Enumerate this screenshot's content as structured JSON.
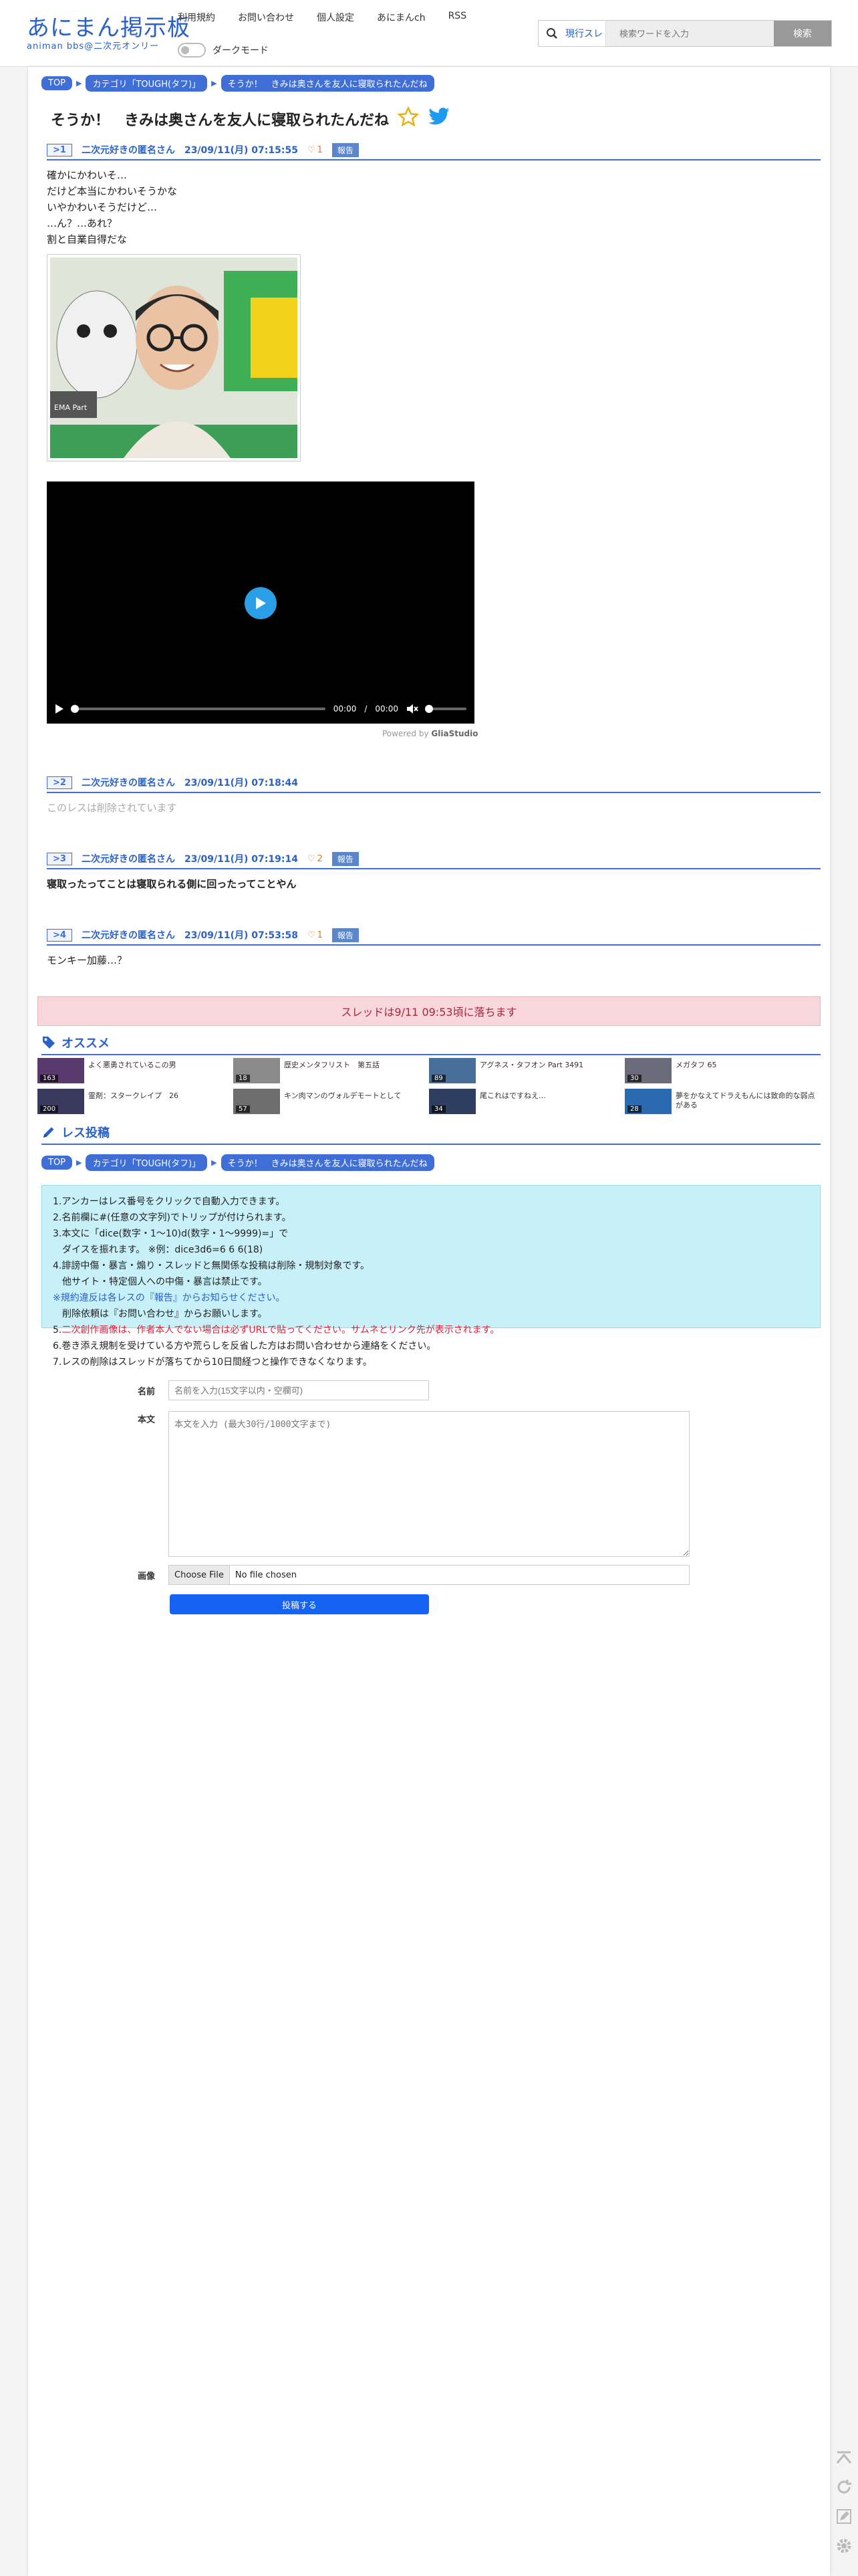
{
  "header": {
    "logo_main": "あにまん掲示板",
    "logo_sub": "animan bbs@二次元オンリー",
    "nav": [
      "利用規約",
      "お問い合わせ",
      "個人設定",
      "あにまんch",
      "RSS"
    ],
    "dark_mode_label": "ダークモード",
    "search_type": "現行スレ",
    "search_placeholder": "検索ワードを入力",
    "search_button": "検索"
  },
  "breadcrumb": {
    "top": "TOP",
    "category": "カテゴリ「TOUGH(タフ)」",
    "thread": "そうか！　きみは奥さんを友人に寝取られたんだね"
  },
  "thread": {
    "title": "そうか！　きみは奥さんを友人に寝取られたんだね"
  },
  "posts": [
    {
      "num": ">1",
      "name": "二次元好きの匿名さん",
      "date": "23/09/11(月) 07:15:55",
      "likes": "1",
      "report": "報告",
      "lines": [
        "確かにかわいそ…",
        "だけど本当にかわいそうかな",
        "いやかわいそうだけど…",
        "…ん？…あれ？",
        "割と自業自得だな"
      ]
    },
    {
      "num": ">2",
      "name": "二次元好きの匿名さん",
      "date": "23/09/11(月) 07:18:44",
      "deleted": "このレスは削除されています"
    },
    {
      "num": ">3",
      "name": "二次元好きの匿名さん",
      "date": "23/09/11(月) 07:19:14",
      "likes": "2",
      "report": "報告",
      "body": "寝取ったってことは寝取られる側に回ったってことやん"
    },
    {
      "num": ">4",
      "name": "二次元好きの匿名さん",
      "date": "23/09/11(月) 07:53:58",
      "likes": "1",
      "report": "報告",
      "body": "モンキー加藤…？"
    }
  ],
  "photo": {
    "caption": "EMA Part"
  },
  "video": {
    "time_current": "00:00",
    "time_sep": "/",
    "time_total": "00:00",
    "powered_by": "Powered by",
    "powered_brand": "GliaStudio"
  },
  "fall_notice": "スレッドは9/11 09:53頃に落ちます",
  "recommend": {
    "title": "オススメ",
    "items": [
      {
        "text": "よく悪勇されているこの男",
        "count": "163",
        "color": "#5a3a6e"
      },
      {
        "text": "歴史メンタフリスト　第五話",
        "count": "18",
        "color": "#8a8a8a"
      },
      {
        "text": "アグネス・タフオン Part 3491",
        "count": "89",
        "color": "#4a6e9a"
      },
      {
        "text": "メガタフ 65",
        "count": "30",
        "color": "#6a6a7a"
      },
      {
        "text": "霊剤：スタークレイプ　26",
        "count": "200",
        "color": "#3a3a5e"
      },
      {
        "text": "キン肉マンのヴォルデモートとして",
        "count": "57",
        "color": "#6e6e6e"
      },
      {
        "text": "尾これはですねえ…",
        "count": "34",
        "color": "#2e3e5e"
      },
      {
        "text": "夢をかなえてドラえもんには致命的な弱点がある",
        "count": "28",
        "color": "#2a6ab0"
      }
    ]
  },
  "reply": {
    "title": "レス投稿",
    "rules": [
      "1.アンカーはレス番号をクリックで自動入力できます。",
      "2.名前欄に#(任意の文字列)でトリップが付けられます。",
      "3.本文に「dice(数字・1〜10)d(数字・1〜9999)=」で",
      "　ダイスを振れます。 ※例：dice3d6=6 6 6(18)",
      "4.誹謗中傷・暴言・煽り・スレッドと無関係な投稿は削除・規制対象です。",
      "　他サイト・特定個人への中傷・暴言は禁止です。",
      "※規約違反は各レスの『報告』からお知らせください。",
      "　削除依頼は『お問い合わせ』からお願いします。"
    ],
    "rule5_prefix": "5.",
    "rule5_red": "二次創作画像は、作者本人でない場合は必ずURLで貼ってください。サムネとリンク先が表示されます。",
    "rule6": "6.巻き添え規制を受けている方や荒らしを反省した方はお問い合わせから連絡をください。",
    "rule7": "7.レスの削除はスレッドが落ちてから10日間経つと操作できなくなります。",
    "name_label": "名前",
    "name_placeholder": "名前を入力(15文字以内・空欄可)",
    "body_label": "本文",
    "body_placeholder": "本文を入力 (最大30行/1000文字まで)",
    "image_label": "画像",
    "file_button": "Choose File",
    "file_status": "No file chosen",
    "submit": "投稿する"
  }
}
